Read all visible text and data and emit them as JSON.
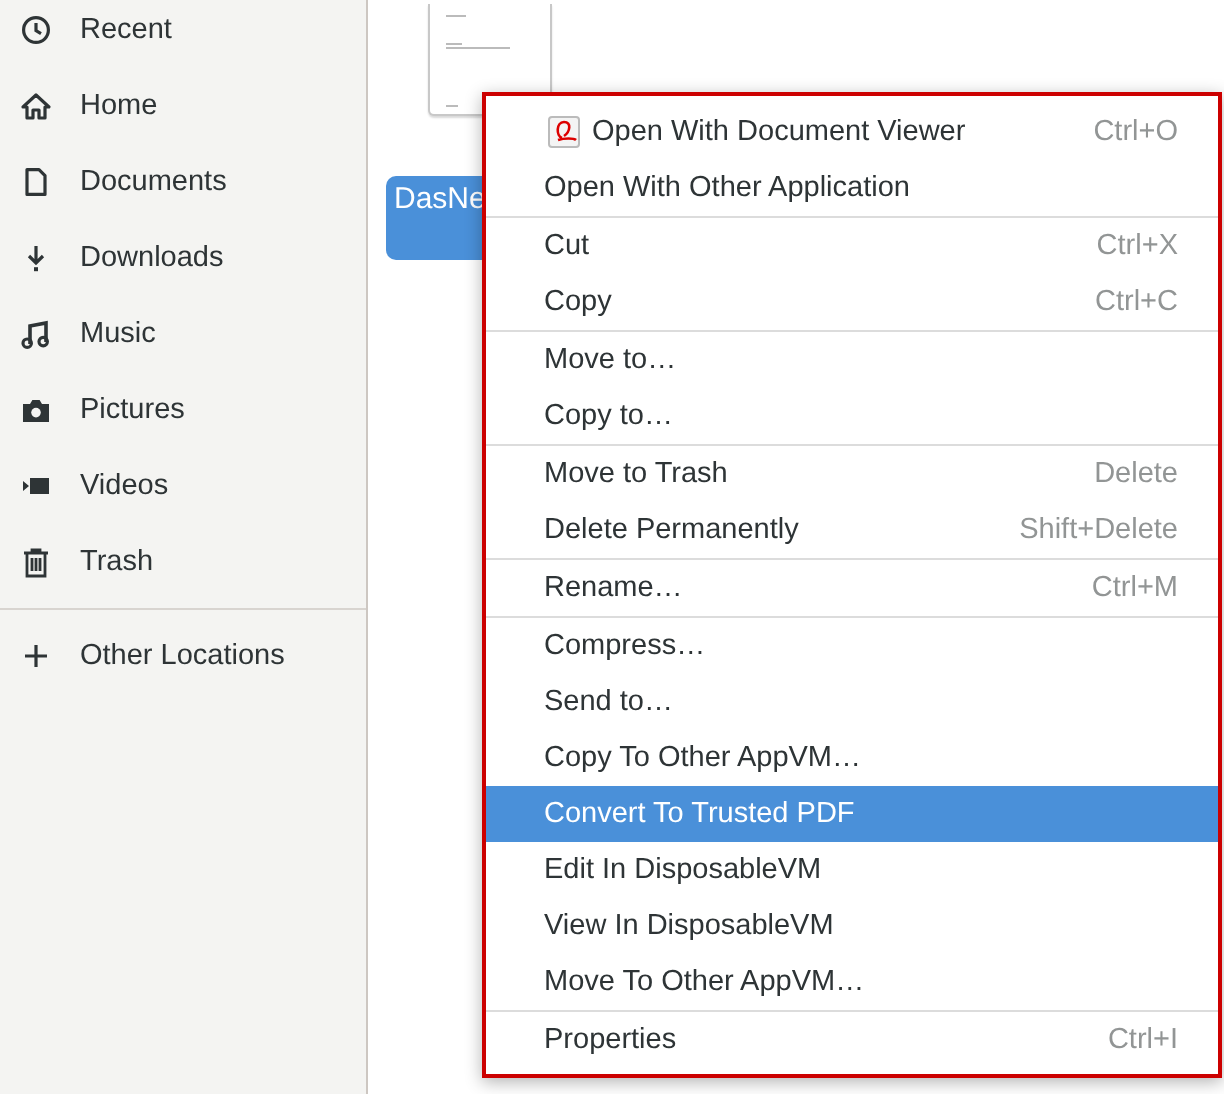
{
  "sidebar": {
    "places": [
      {
        "label": "Recent"
      },
      {
        "label": "Home"
      },
      {
        "label": "Documents"
      },
      {
        "label": "Downloads"
      },
      {
        "label": "Music"
      },
      {
        "label": "Pictures"
      },
      {
        "label": "Videos"
      },
      {
        "label": "Trash"
      }
    ],
    "other": [
      {
        "label": "Other Locations"
      }
    ]
  },
  "file": {
    "name": "DasNe",
    "selected": true
  },
  "context_menu": {
    "sections": [
      [
        {
          "label": "Open With Document Viewer",
          "shortcut": "Ctrl+O",
          "kind": "app",
          "selected": false
        },
        {
          "label": "Open With Other Application",
          "kind": "plain",
          "selected": false
        }
      ],
      [
        {
          "label": "Cut",
          "shortcut": "Ctrl+X",
          "kind": "plain",
          "selected": false
        },
        {
          "label": "Copy",
          "shortcut": "Ctrl+C",
          "kind": "plain",
          "selected": false
        }
      ],
      [
        {
          "label": "Move to…",
          "kind": "plain",
          "selected": false
        },
        {
          "label": "Copy to…",
          "kind": "plain",
          "selected": false
        }
      ],
      [
        {
          "label": "Move to Trash",
          "shortcut": "Delete",
          "kind": "plain",
          "selected": false
        },
        {
          "label": "Delete Permanently",
          "shortcut": "Shift+Delete",
          "kind": "plain",
          "selected": false
        }
      ],
      [
        {
          "label": "Rename…",
          "shortcut": "Ctrl+M",
          "kind": "plain",
          "selected": false
        }
      ],
      [
        {
          "label": "Compress…",
          "kind": "plain",
          "selected": false
        },
        {
          "label": "Send to…",
          "kind": "plain",
          "selected": false
        },
        {
          "label": "Copy To Other AppVM…",
          "kind": "plain",
          "selected": false
        },
        {
          "label": "Convert To Trusted PDF",
          "kind": "plain",
          "selected": true
        },
        {
          "label": "Edit In DisposableVM",
          "kind": "plain",
          "selected": false
        },
        {
          "label": "View In DisposableVM",
          "kind": "plain",
          "selected": false
        },
        {
          "label": "Move To Other AppVM…",
          "kind": "plain",
          "selected": false
        }
      ],
      [
        {
          "label": "Properties",
          "shortcut": "Ctrl+I",
          "kind": "plain",
          "selected": false
        }
      ]
    ]
  }
}
